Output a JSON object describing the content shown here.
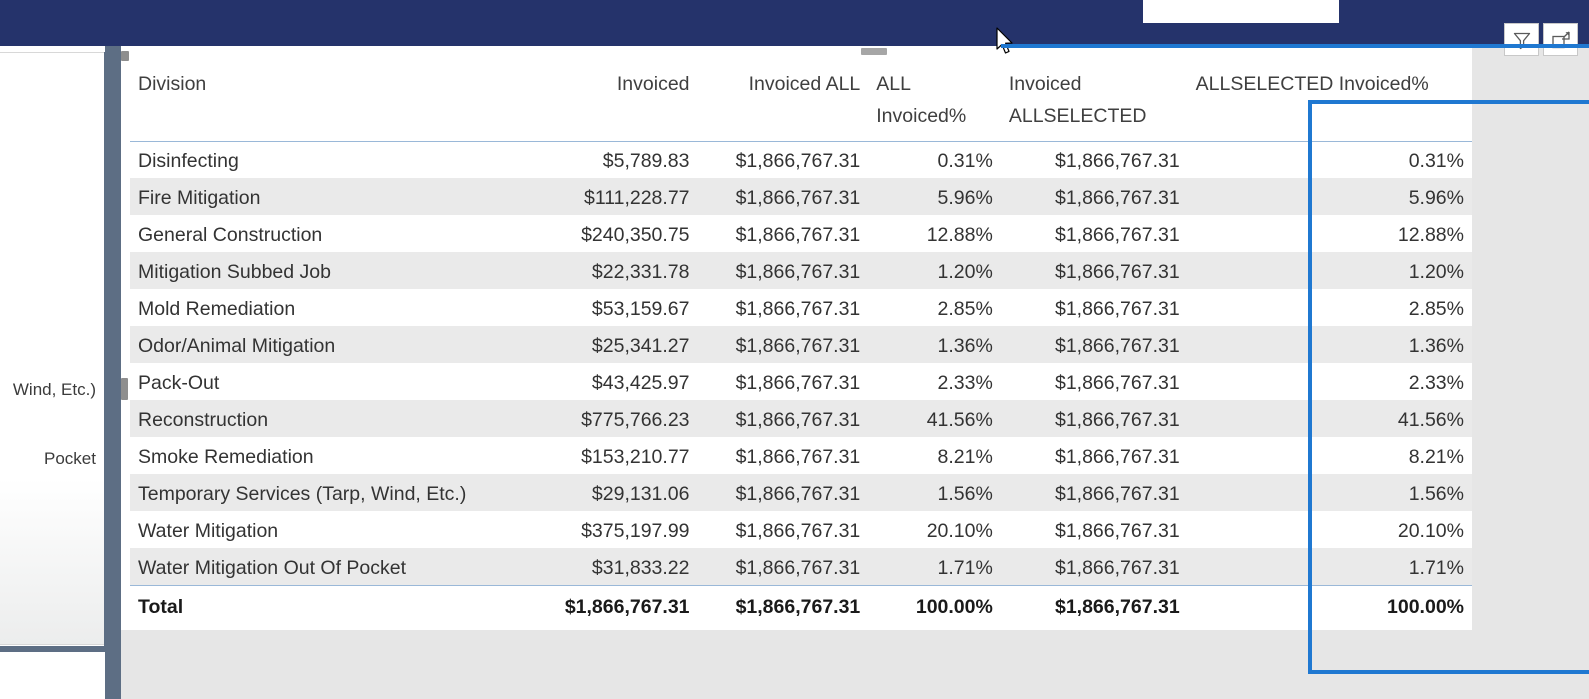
{
  "ribbon": {
    "background_color": "#25336b",
    "buttons": [
      {
        "name": "filter-icon",
        "label": "Filters"
      },
      {
        "name": "focus-mode-icon",
        "label": "Focus mode"
      }
    ]
  },
  "background_panel": {
    "clipped_labels": [
      "Wind, Etc.)",
      "Pocket"
    ]
  },
  "visual": {
    "type": "matrix-table",
    "highlight_color": "#1f78d1",
    "highlighted_column": "ALLSELECTED Invoiced%",
    "columns": [
      "Division",
      "Invoiced",
      "Invoiced ALL",
      "ALL Invoiced%",
      "Invoiced ALLSELECTED",
      "ALLSELECTED Invoiced%"
    ],
    "rows": [
      {
        "division": "Disinfecting",
        "invoiced": "$5,789.83",
        "invoiced_all": "$1,866,767.31",
        "all_invoiced_pct": "0.31%",
        "invoiced_allselected": "$1,866,767.31",
        "allselected_invoiced_pct": "0.31%"
      },
      {
        "division": "Fire Mitigation",
        "invoiced": "$111,228.77",
        "invoiced_all": "$1,866,767.31",
        "all_invoiced_pct": "5.96%",
        "invoiced_allselected": "$1,866,767.31",
        "allselected_invoiced_pct": "5.96%"
      },
      {
        "division": "General Construction",
        "invoiced": "$240,350.75",
        "invoiced_all": "$1,866,767.31",
        "all_invoiced_pct": "12.88%",
        "invoiced_allselected": "$1,866,767.31",
        "allselected_invoiced_pct": "12.88%"
      },
      {
        "division": "Mitigation Subbed Job",
        "invoiced": "$22,331.78",
        "invoiced_all": "$1,866,767.31",
        "all_invoiced_pct": "1.20%",
        "invoiced_allselected": "$1,866,767.31",
        "allselected_invoiced_pct": "1.20%"
      },
      {
        "division": "Mold Remediation",
        "invoiced": "$53,159.67",
        "invoiced_all": "$1,866,767.31",
        "all_invoiced_pct": "2.85%",
        "invoiced_allselected": "$1,866,767.31",
        "allselected_invoiced_pct": "2.85%"
      },
      {
        "division": "Odor/Animal Mitigation",
        "invoiced": "$25,341.27",
        "invoiced_all": "$1,866,767.31",
        "all_invoiced_pct": "1.36%",
        "invoiced_allselected": "$1,866,767.31",
        "allselected_invoiced_pct": "1.36%"
      },
      {
        "division": "Pack-Out",
        "invoiced": "$43,425.97",
        "invoiced_all": "$1,866,767.31",
        "all_invoiced_pct": "2.33%",
        "invoiced_allselected": "$1,866,767.31",
        "allselected_invoiced_pct": "2.33%"
      },
      {
        "division": "Reconstruction",
        "invoiced": "$775,766.23",
        "invoiced_all": "$1,866,767.31",
        "all_invoiced_pct": "41.56%",
        "invoiced_allselected": "$1,866,767.31",
        "allselected_invoiced_pct": "41.56%"
      },
      {
        "division": "Smoke Remediation",
        "invoiced": "$153,210.77",
        "invoiced_all": "$1,866,767.31",
        "all_invoiced_pct": "8.21%",
        "invoiced_allselected": "$1,866,767.31",
        "allselected_invoiced_pct": "8.21%"
      },
      {
        "division": "Temporary Services (Tarp, Wind, Etc.)",
        "invoiced": "$29,131.06",
        "invoiced_all": "$1,866,767.31",
        "all_invoiced_pct": "1.56%",
        "invoiced_allselected": "$1,866,767.31",
        "allselected_invoiced_pct": "1.56%"
      },
      {
        "division": "Water Mitigation",
        "invoiced": "$375,197.99",
        "invoiced_all": "$1,866,767.31",
        "all_invoiced_pct": "20.10%",
        "invoiced_allselected": "$1,866,767.31",
        "allselected_invoiced_pct": "20.10%"
      },
      {
        "division": "Water Mitigation Out Of Pocket",
        "invoiced": "$31,833.22",
        "invoiced_all": "$1,866,767.31",
        "all_invoiced_pct": "1.71%",
        "invoiced_allselected": "$1,866,767.31",
        "allselected_invoiced_pct": "1.71%"
      }
    ],
    "total": {
      "division": "Total",
      "invoiced": "$1,866,767.31",
      "invoiced_all": "$1,866,767.31",
      "all_invoiced_pct": "100.00%",
      "invoiced_allselected": "$1,866,767.31",
      "allselected_invoiced_pct": "100.00%"
    }
  }
}
